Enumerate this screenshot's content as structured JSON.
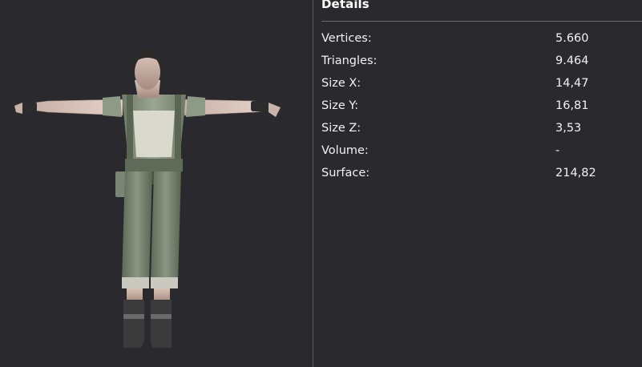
{
  "details": {
    "title": "Details",
    "rows": [
      {
        "label": "Vertices:",
        "value": "5.660"
      },
      {
        "label": "Triangles:",
        "value": "9.464"
      },
      {
        "label": "Size X:",
        "value": "14,47"
      },
      {
        "label": "Size Y:",
        "value": "16,81"
      },
      {
        "label": "Size Z:",
        "value": "3,53"
      },
      {
        "label": "Volume:",
        "value": "-"
      },
      {
        "label": "Surface:",
        "value": "214,82"
      }
    ]
  },
  "colors": {
    "background": "#2a2a2e",
    "divider": "#5a5a60",
    "text": "#f2f2f2"
  },
  "viewport": {
    "subject": "3d-character-model-t-pose"
  }
}
